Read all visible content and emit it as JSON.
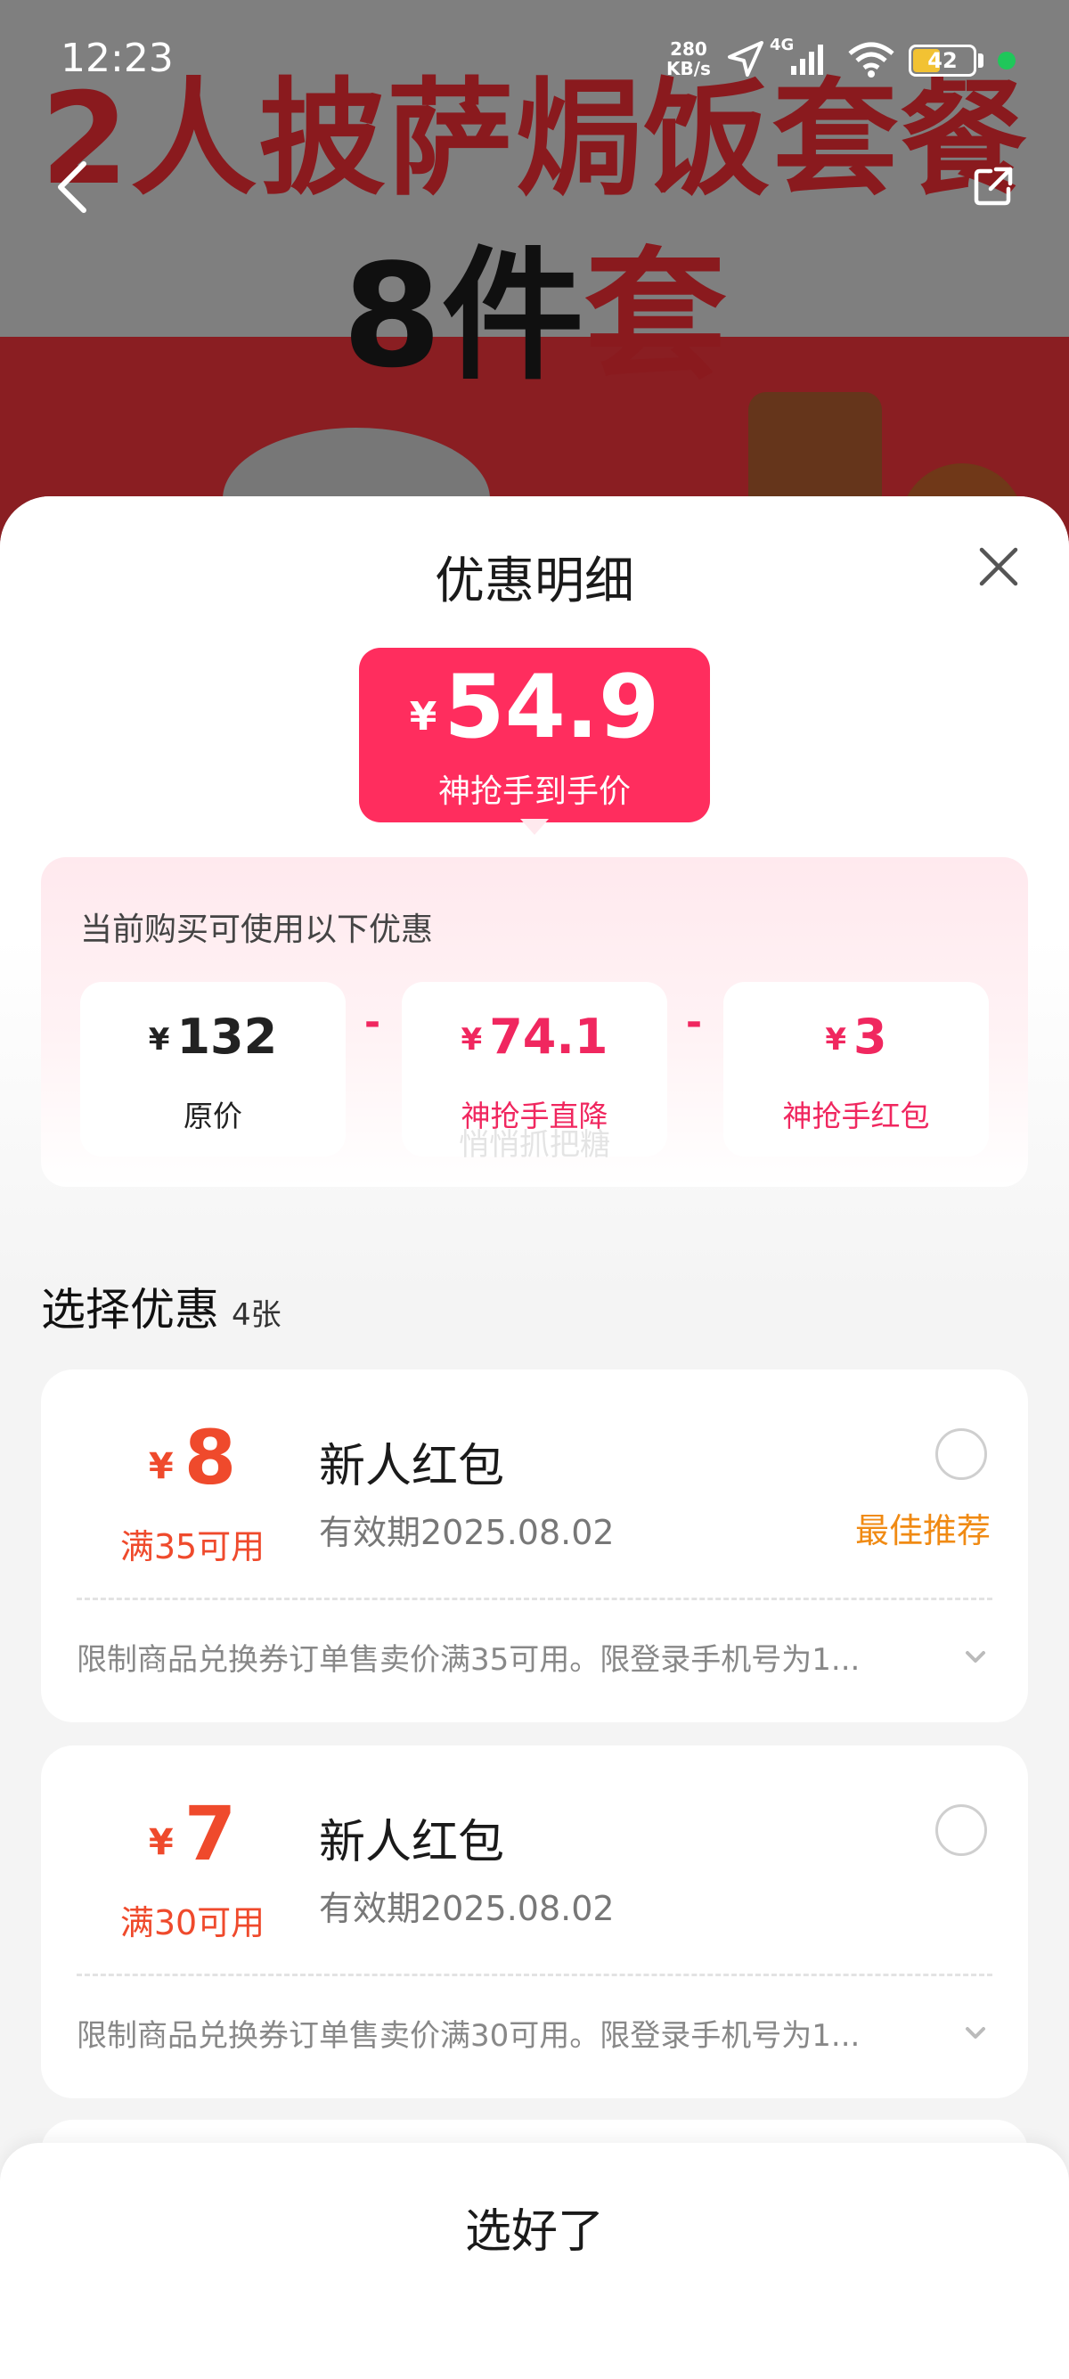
{
  "status_bar": {
    "time": "12:23",
    "speed_value": "280",
    "speed_unit": "KB/s",
    "network": "4G",
    "battery": "42"
  },
  "banner": {
    "headline": "2人披萨焗饭套餐",
    "subline_number": "8件",
    "subline_word": "套"
  },
  "sheet": {
    "title": "优惠明细"
  },
  "price": {
    "currency": "¥",
    "amount": "54.9",
    "label": "神抢手到手价"
  },
  "breakdown": {
    "hint": "当前购买可使用以下优惠",
    "items": [
      {
        "currency": "¥",
        "value": "132",
        "label": "原价"
      },
      {
        "currency": "¥",
        "value": "74.1",
        "label": "神抢手直降"
      },
      {
        "currency": "¥",
        "value": "3",
        "label": "神抢手红包"
      }
    ],
    "operator": "-"
  },
  "watermark": "悄悄抓把糖",
  "select": {
    "title": "选择优惠",
    "count": "4张"
  },
  "coupons": [
    {
      "currency": "¥",
      "amount": "8",
      "condition": "满35可用",
      "name": "新人红包",
      "expiry": "有效期2025.08.02",
      "badge": "最佳推荐",
      "description": "限制商品兑换券订单售卖价满35可用。限登录手机号为1..."
    },
    {
      "currency": "¥",
      "amount": "7",
      "condition": "满30可用",
      "name": "新人红包",
      "expiry": "有效期2025.08.02",
      "badge": "",
      "description": "限制商品兑换券订单售卖价满30可用。限登录手机号为1..."
    }
  ],
  "footer": {
    "confirm_label": "选好了"
  },
  "colors": {
    "accent": "#ff2d5e",
    "coupon_red": "#ef4a2c",
    "recommend": "#f08a13"
  },
  "icons": {
    "back": "chevron-left-icon",
    "share": "share-icon",
    "close": "close-icon",
    "expand": "chevron-down-icon"
  }
}
